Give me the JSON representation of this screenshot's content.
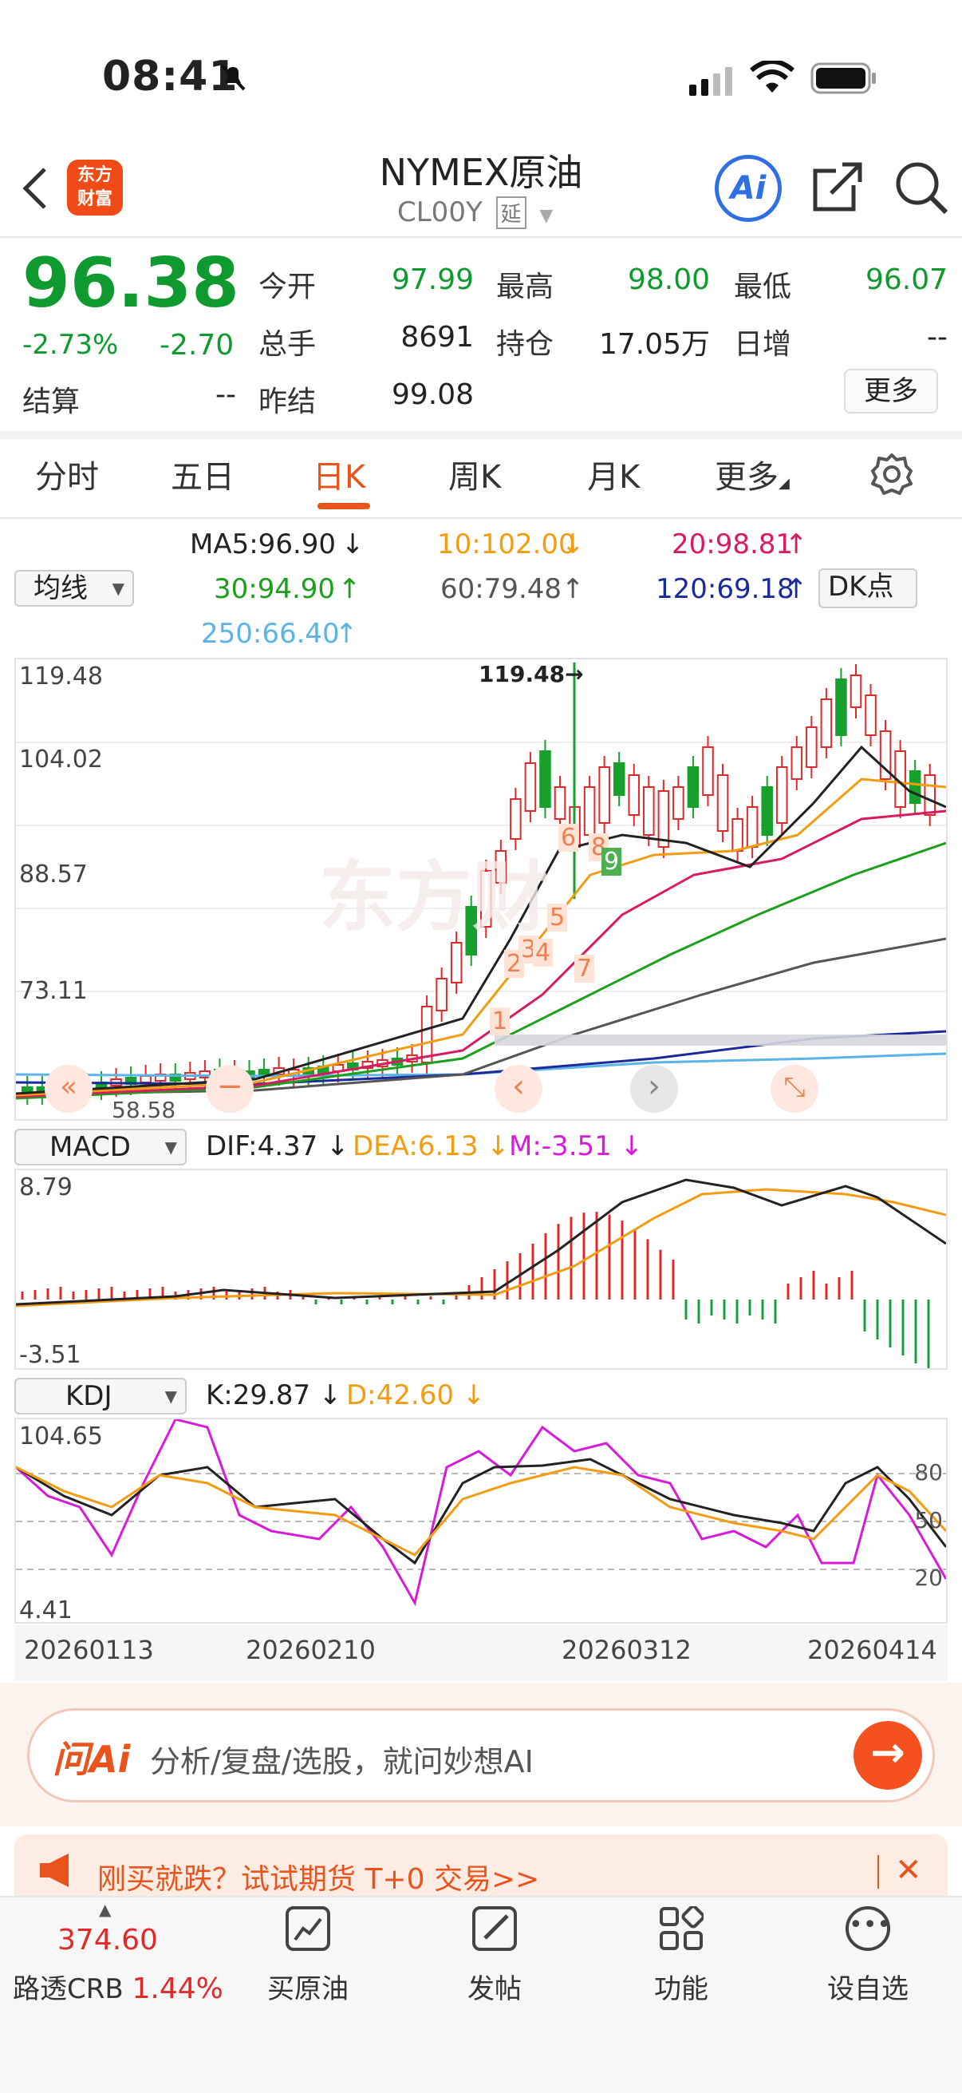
{
  "status": {
    "time": "08:41"
  },
  "header": {
    "logo_text": "东方财富",
    "title": "NYMEX原油",
    "code": "CL00Y",
    "delay_badge": "延",
    "ai_label": "Ai"
  },
  "quote": {
    "price": "96.38",
    "change_pct": "-2.73%",
    "change": "-2.70",
    "settle_label": "结算",
    "settle_value": "--",
    "open_label": "今开",
    "open_value": "97.99",
    "high_label": "最高",
    "high_value": "98.00",
    "low_label": "最低",
    "low_value": "96.07",
    "volume_label": "总手",
    "volume_value": "8691",
    "oi_label": "持仓",
    "oi_value": "17.05万",
    "daily_inc_label": "日增",
    "daily_inc_value": "--",
    "prev_settle_label": "昨结",
    "prev_settle_value": "99.08",
    "more_label": "更多"
  },
  "tabs": [
    {
      "label": "分时"
    },
    {
      "label": "五日"
    },
    {
      "label": "日K"
    },
    {
      "label": "周K"
    },
    {
      "label": "月K"
    },
    {
      "label": "更多"
    }
  ],
  "ma": {
    "selector": "均线",
    "ma5": "MA5:96.90",
    "ma10": "10:102.00",
    "ma20": "20:98.81",
    "ma30": "30:94.90",
    "ma60": "60:79.48",
    "ma120": "120:69.18",
    "ma250": "250:66.40",
    "dk_label": "DK点",
    "colors": {
      "ma5": "#222222",
      "ma10": "#f39c12",
      "ma20": "#d81b60",
      "ma30": "#1aa01a",
      "ma60": "#555555",
      "ma120": "#1a2a9a",
      "ma250": "#5ab4e8"
    }
  },
  "kline": {
    "y_labels": [
      "119.48",
      "104.02",
      "88.57",
      "73.11"
    ],
    "high_marker": "119.48",
    "low_marker": "58.58",
    "td_marks": [
      "1",
      "2",
      "3",
      "4",
      "5",
      "6",
      "7",
      "8",
      "9"
    ],
    "watermark": "东方财"
  },
  "macd": {
    "selector": "MACD",
    "dif": "DIF:4.37",
    "dea": "DEA:6.13",
    "m": "M:-3.51",
    "y_top": "8.79",
    "y_bottom": "-3.51"
  },
  "kdj": {
    "selector": "KDJ",
    "k": "K:29.87",
    "d": "D:42.60",
    "y_top": "104.65",
    "y_bottom": "4.41",
    "levels": [
      "80",
      "50",
      "20"
    ]
  },
  "dates": [
    "20260113",
    "20260210",
    "20260312",
    "20260414"
  ],
  "ask_ai": {
    "icon_text": "问Ai",
    "placeholder": "分析/复盘/选股，就问妙想AI"
  },
  "promo": {
    "text": "刚买就跌？试试期货 T+0 交易>>"
  },
  "bottom_nav": {
    "index_value": "374.60",
    "index_name": "路透CRB",
    "index_pct": "1.44%",
    "items": [
      {
        "label": "买原油",
        "icon": "chart-icon"
      },
      {
        "label": "发帖",
        "icon": "edit-icon"
      },
      {
        "label": "功能",
        "icon": "grid-icon"
      },
      {
        "label": "设自选",
        "icon": "more-icon"
      }
    ]
  }
}
